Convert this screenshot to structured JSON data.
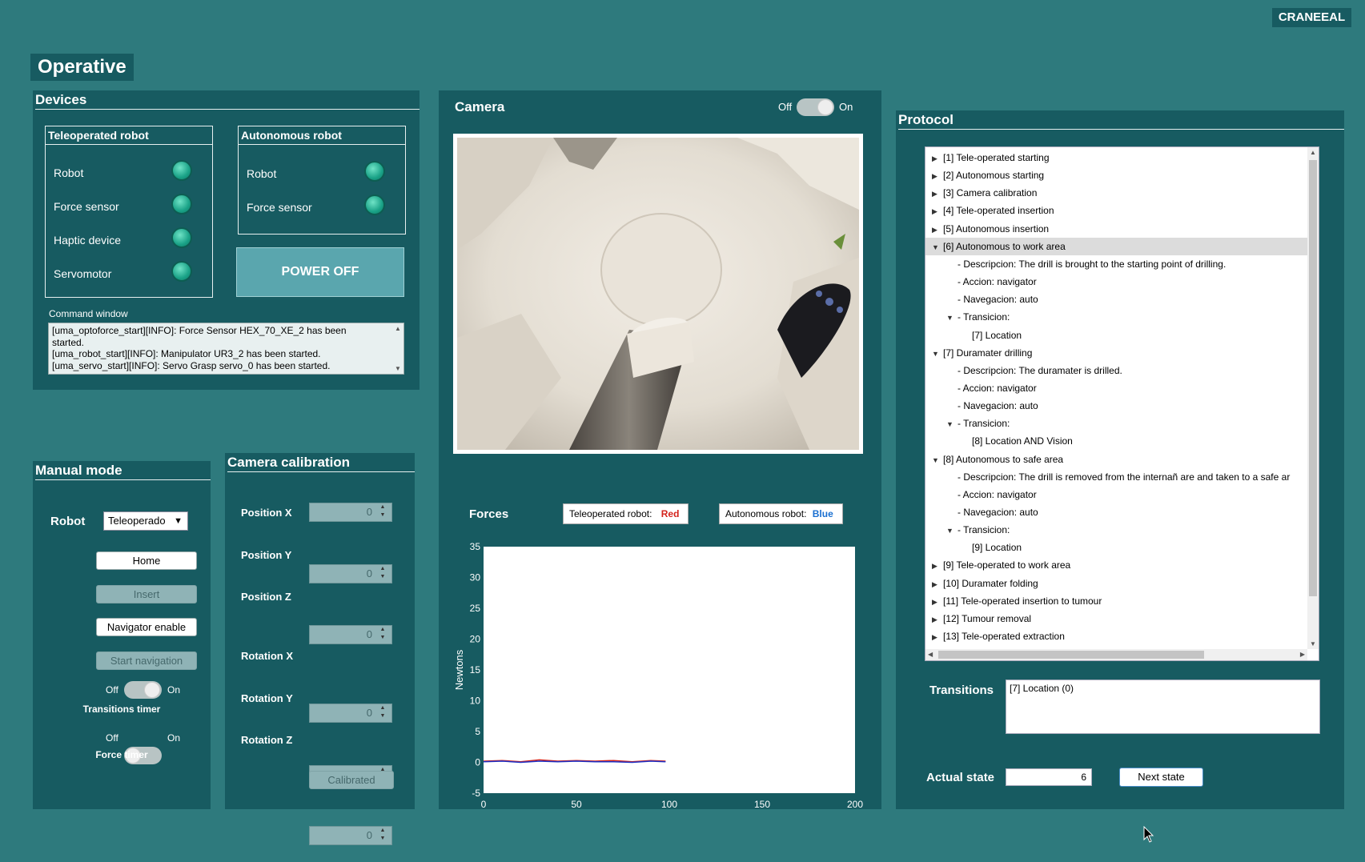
{
  "brand": "CRANEEAL",
  "page_title": "Operative",
  "devices": {
    "title": "Devices",
    "teleoperated": {
      "title": "Teleoperated robot",
      "items": [
        "Robot",
        "Force sensor",
        "Haptic device",
        "Servomotor"
      ]
    },
    "autonomous": {
      "title": "Autonomous robot",
      "items": [
        "Robot",
        "Force sensor"
      ]
    },
    "power_button": "POWER OFF",
    "command_window_label": "Command window",
    "command_lines": [
      "[uma_optoforce_start][INFO]: Force Sensor HEX_70_XE_2 has been",
      "started.",
      "[uma_robot_start][INFO]: Manipulator UR3_2 has been started.",
      "[uma_servo_start][INFO]: Servo Grasp servo_0 has been started."
    ]
  },
  "camera": {
    "title": "Camera",
    "toggle_off": "Off",
    "toggle_on": "On"
  },
  "forces": {
    "title": "Forces",
    "legend_tele_label": "Teleoperated robot:",
    "legend_tele_color": "Red",
    "legend_auto_label": "Autonomous robot:",
    "legend_auto_color": "Blue"
  },
  "manual_mode": {
    "title": "Manual mode",
    "robot_label": "Robot",
    "robot_select": "Teleoperado",
    "buttons": {
      "home": "Home",
      "insert": "Insert",
      "navigator": "Navigator enable",
      "start_nav": "Start navigation"
    },
    "toggle_off": "Off",
    "toggle_on": "On",
    "transitions_timer": "Transitions timer",
    "force_timer": "Force timer"
  },
  "camera_calibration": {
    "title": "Camera calibration",
    "fields": [
      {
        "label": "Position X",
        "value": "0"
      },
      {
        "label": "Position Y",
        "value": "0"
      },
      {
        "label": "Position Z",
        "value": "0"
      },
      {
        "label": "Rotation X",
        "value": "0"
      },
      {
        "label": "Rotation Y",
        "value": "0"
      },
      {
        "label": "Rotation Z",
        "value": "0"
      }
    ],
    "calibrated_button": "Calibrated"
  },
  "protocol": {
    "title": "Protocol",
    "tree": [
      {
        "text": "[1] Tele-operated starting",
        "level": 0,
        "expanded": false
      },
      {
        "text": "[2] Autonomous starting",
        "level": 0,
        "expanded": false
      },
      {
        "text": "[3] Camera calibration",
        "level": 0,
        "expanded": false
      },
      {
        "text": "[4] Tele-operated insertion",
        "level": 0,
        "expanded": false
      },
      {
        "text": "[5] Autonomous insertion",
        "level": 0,
        "expanded": false
      },
      {
        "text": "[6] Autonomous to work area",
        "level": 0,
        "expanded": true,
        "selected": true
      },
      {
        "text": "- Descripcion: The drill is brought to the starting point of drilling.",
        "level": 1
      },
      {
        "text": "- Accion: navigator",
        "level": 1
      },
      {
        "text": "- Navegacion: auto",
        "level": 1
      },
      {
        "text": "- Transicion:",
        "level": 1,
        "expanded": true
      },
      {
        "text": "[7] Location",
        "level": 2
      },
      {
        "text": "[7] Duramater drilling",
        "level": 0,
        "expanded": true
      },
      {
        "text": "- Descripcion: The duramater is drilled.",
        "level": 1
      },
      {
        "text": "- Accion: navigator",
        "level": 1
      },
      {
        "text": "- Navegacion: auto",
        "level": 1
      },
      {
        "text": "- Transicion:",
        "level": 1,
        "expanded": true
      },
      {
        "text": "[8] Location AND Vision",
        "level": 2
      },
      {
        "text": "[8] Autonomous to safe area",
        "level": 0,
        "expanded": true
      },
      {
        "text": "- Descripcion: The drill is removed from the internañ are and taken to a safe ar",
        "level": 1
      },
      {
        "text": "- Accion: navigator",
        "level": 1
      },
      {
        "text": "- Navegacion: auto",
        "level": 1
      },
      {
        "text": "- Transicion:",
        "level": 1,
        "expanded": true
      },
      {
        "text": "[9] Location",
        "level": 2
      },
      {
        "text": "[9] Tele-operated to work area",
        "level": 0,
        "expanded": false
      },
      {
        "text": "[10] Duramater folding",
        "level": 0,
        "expanded": false
      },
      {
        "text": "[11] Tele-operated insertion to tumour",
        "level": 0,
        "expanded": false
      },
      {
        "text": "[12] Tumour removal",
        "level": 0,
        "expanded": false
      },
      {
        "text": "[13] Tele-operated extraction",
        "level": 0,
        "expanded": false
      }
    ],
    "transitions_label": "Transitions",
    "transitions_value": "[7] Location (0)",
    "actual_state_label": "Actual state",
    "actual_state_value": "6",
    "next_state_button": "Next state"
  },
  "chart_data": {
    "type": "line",
    "title": "Forces",
    "xlabel": "",
    "ylabel": "Newtons",
    "xlim": [
      0,
      200
    ],
    "ylim": [
      -5,
      35
    ],
    "xticks": [
      0,
      50,
      100,
      150,
      200
    ],
    "yticks": [
      -5,
      0,
      5,
      10,
      15,
      20,
      25,
      30,
      35
    ],
    "series": [
      {
        "name": "Teleoperated robot",
        "color": "#d4231c",
        "x": [
          0,
          10,
          20,
          30,
          40,
          50,
          60,
          70,
          80,
          90,
          98
        ],
        "y": [
          0.2,
          0.3,
          0.1,
          0.4,
          0.2,
          0.3,
          0.2,
          0.3,
          0.1,
          0.3,
          0.2
        ]
      },
      {
        "name": "Autonomous robot",
        "color": "#1d33c9",
        "x": [
          0,
          10,
          20,
          30,
          40,
          50,
          60,
          70,
          80,
          90,
          98
        ],
        "y": [
          0.1,
          0.2,
          0.0,
          0.2,
          0.1,
          0.2,
          0.1,
          0.1,
          0.0,
          0.2,
          0.1
        ]
      }
    ],
    "grid": false
  }
}
